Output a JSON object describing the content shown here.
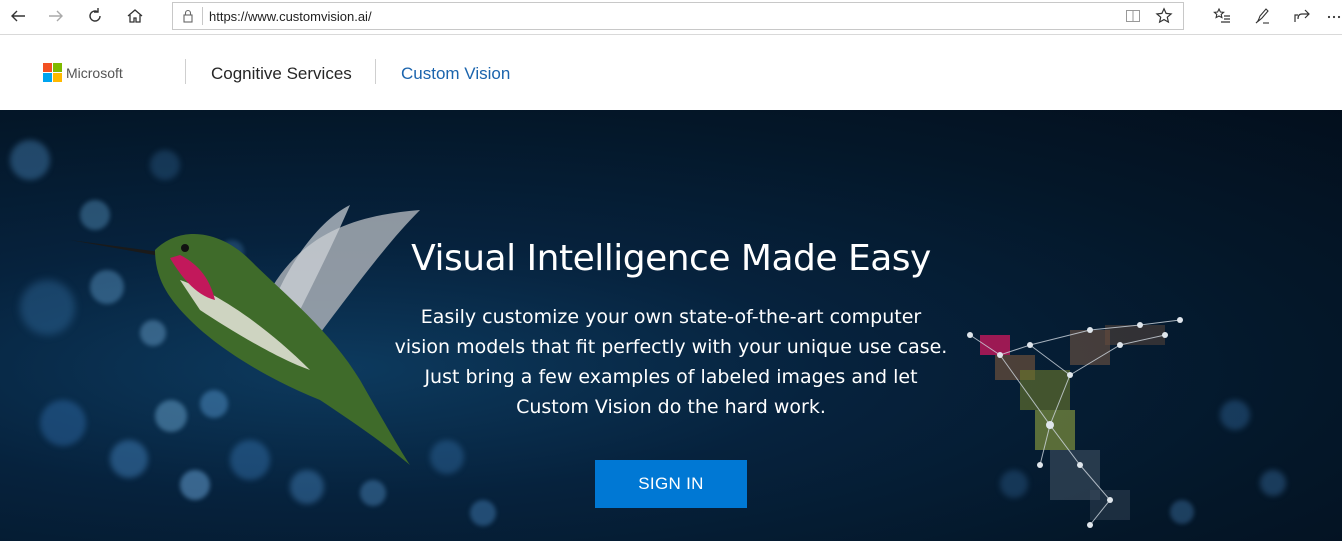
{
  "browser": {
    "url": "https://www.customvision.ai/"
  },
  "header": {
    "brand": "Microsoft",
    "cognitive_services": "Cognitive Services",
    "custom_vision": "Custom Vision"
  },
  "hero": {
    "title": "Visual Intelligence Made Easy",
    "description": "Easily customize your own state-of-the-art computer vision models that fit perfectly with your unique use case. Just bring a few examples of labeled images and let Custom Vision do the hard work.",
    "signin_label": "SIGN IN"
  },
  "colors": {
    "accent": "#0078d4",
    "link": "#1b64ad",
    "hero_bg": "#041729"
  }
}
